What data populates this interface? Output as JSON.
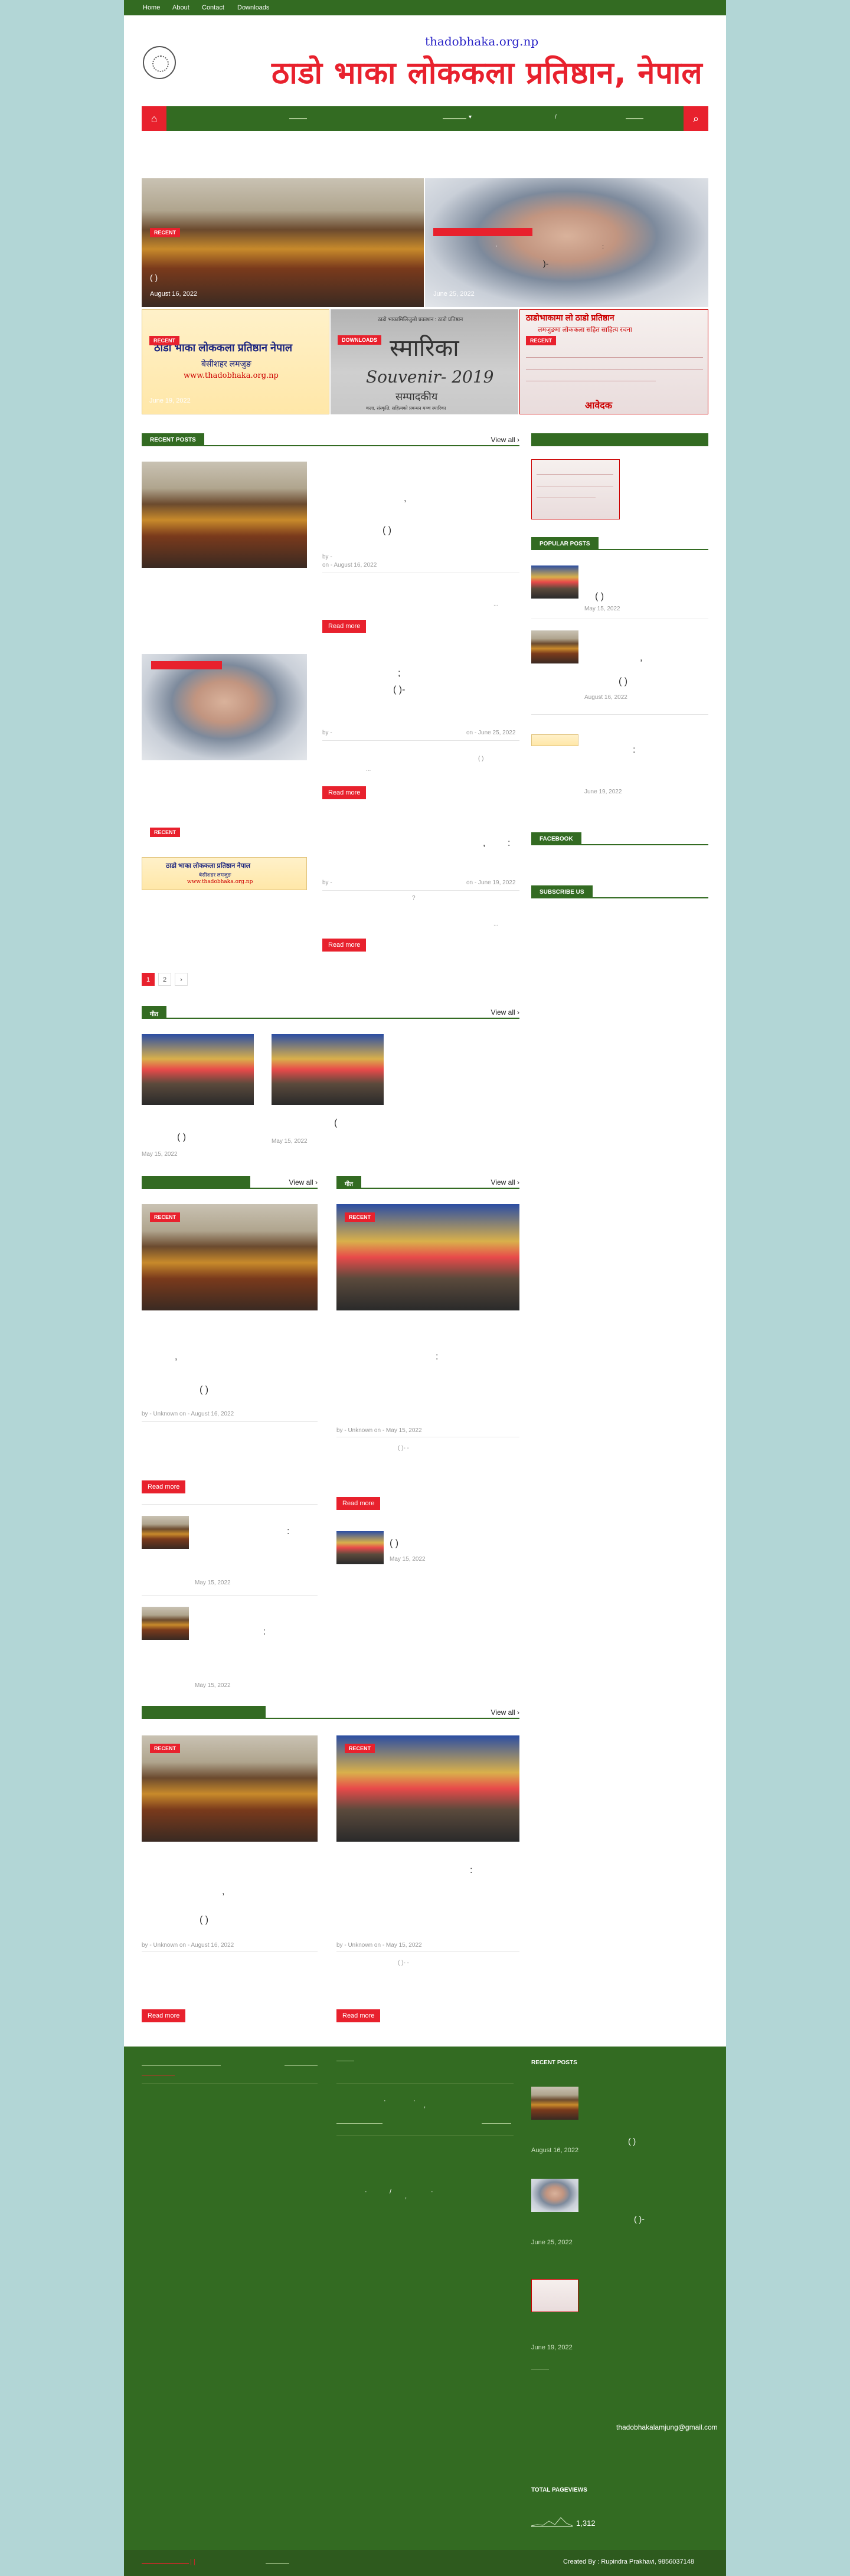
{
  "topbar": {
    "home": "Home",
    "about": "About",
    "contact": "Contact",
    "downloads": "Downloads"
  },
  "brand": {
    "url": "thadobhaka.org.np",
    "name": "ठाडो भाका लोककला प्रतिष्ठान, नेपाल"
  },
  "nav": {
    "home_icon": "home-icon",
    "search_icon": "search-icon",
    "accent": "#e8212d",
    "green": "#336b22"
  },
  "featured": {
    "tag_recent": "RECENT",
    "tag_download": "DOWNLOADS",
    "date1": "August 16, 2022",
    "date2": "June 25, 2022",
    "date3": "June 19, 2022",
    "paren": "(          )",
    "colon": ":",
    "dash": ")-",
    "comma": ","
  },
  "souvenir": {
    "header": "ठाडो भाकामिलिजुलो प्रकाशन : ठाडो प्रतिष्ठान",
    "title": "स्मारिका",
    "sub": "Souvenir- 2019",
    "edit": "सम्पादकीय",
    "foot": "कला, संस्कृति, सहित्यको प्रबन्धन मञ्च स्मारिका"
  },
  "banner": {
    "line1": "ठाडो भाका लोककला प्रतिष्ठान नेपाल",
    "line2": "बेसीशहर लमजुङ",
    "line3": "www.thadobhaka.org.np"
  },
  "poster": {
    "head": "ठाडोभाकामा लो ठाडो प्रतिष्ठान",
    "sub": "लमजुङमा लोककला सहित साहित्य रचना",
    "word": "आवेदक"
  },
  "recent_posts": {
    "label": "RECENT POSTS",
    "view_all": "View all ›",
    "read_more": "Read more",
    "by": "by -",
    "on": "on - August 16, 2022",
    "on2": "on - June 25, 2022",
    "on3": "on - June 19, 2022",
    "comma": ",",
    "paren": "(           )",
    "paren2": "(        )-",
    "dots": "...",
    "q": "?",
    "colon": ":",
    "semicolon": ";",
    "paren3": "(       )"
  },
  "pages": {
    "p1": "1",
    "p2": "2",
    "next": "›"
  },
  "section2": {
    "label": "गीत",
    "date1": "May 15, 2022",
    "date2": "May 15, 2022",
    "paren": "(        )",
    "paren2": "("
  },
  "section3": {
    "label_left": "",
    "view_all": "View all ›",
    "label_right": "गीत",
    "date": "August 16, 2022",
    "date2": "May 15, 2022",
    "by": "by - Unknown on - August 16, 2022",
    "by2": "by - Unknown on - May 15, 2022",
    "paren": "(               )",
    "small_date": "May 15, 2022",
    "colon": ":",
    "dash": "(   )-    -",
    "paren_s": "(       )"
  },
  "section4": {
    "view_all": "View all ›",
    "by": "by - Unknown on - August 16, 2022",
    "by2": "by - Unknown on - May 15, 2022",
    "paren": "(                     )",
    "dash": "(    )-      -",
    "colon": ":",
    "comma": ","
  },
  "sidebar": {
    "popular": "POPULAR POSTS",
    "facebook": "FACEBOOK",
    "subscribe": "SUBSCRIBE US",
    "d1": "May 15, 2022",
    "d2": "August 16, 2022",
    "d3": "June 19, 2022",
    "p1": "(           )",
    "p2": "(        )",
    "colon": ":"
  },
  "footer": {
    "recent": "RECENT POSTS",
    "f1": "August 16, 2022",
    "f2": "June 25, 2022",
    "f3": "June 19, 2022",
    "email": "thadobhakalamjung@gmail.com",
    "pageviews": "TOTAL PAGEVIEWS",
    "count": "1,312",
    "credit": "Created By : Rupindra Prakhavi, 9856037148",
    "paren": "(        )",
    "dash": "(      )-"
  }
}
